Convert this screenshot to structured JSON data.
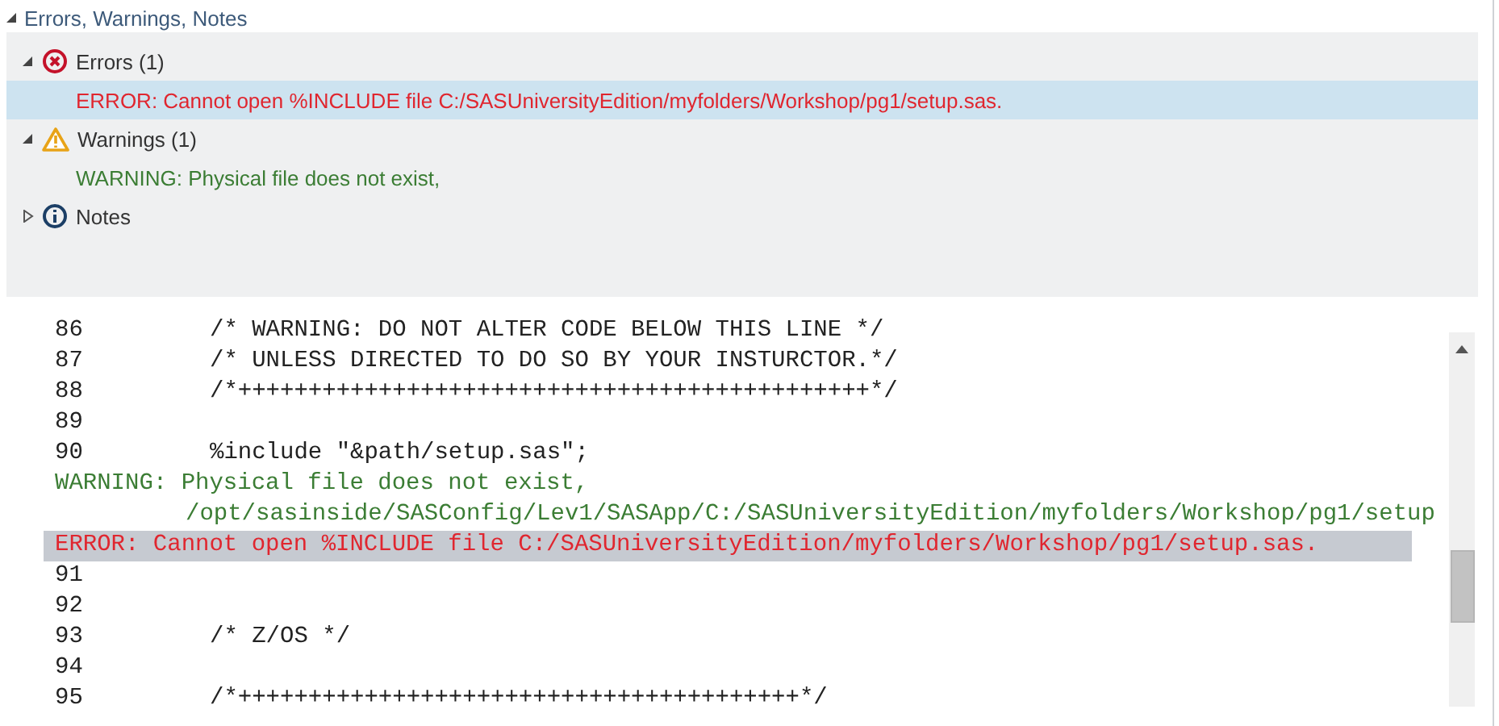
{
  "panel": {
    "title": "Errors, Warnings, Notes",
    "expanded": true,
    "groups": [
      {
        "kind": "error",
        "label": "Errors (1)",
        "expanded": true,
        "messages": [
          {
            "text": "ERROR: Cannot open %INCLUDE file C:/SASUniversityEdition/myfolders/Workshop/pg1/setup.sas.",
            "selected": true
          }
        ]
      },
      {
        "kind": "warning",
        "label": "Warnings (1)",
        "expanded": true,
        "messages": [
          {
            "text": "WARNING: Physical file does not exist,",
            "selected": false
          }
        ]
      },
      {
        "kind": "note",
        "label": "Notes",
        "expanded": false
      }
    ]
  },
  "log": {
    "lines": [
      {
        "kind": "code",
        "number": "86",
        "text": "/* WARNING: DO NOT ALTER CODE BELOW THIS LINE */"
      },
      {
        "kind": "code",
        "number": "87",
        "text": "/* UNLESS DIRECTED TO DO SO BY YOUR INSTURCTOR.*/"
      },
      {
        "kind": "code",
        "number": "88",
        "text": "/*+++++++++++++++++++++++++++++++++++++++++++++*/"
      },
      {
        "kind": "code",
        "number": "89"
      },
      {
        "kind": "code",
        "number": "90",
        "text": "%include \"&path/setup.sas\";"
      },
      {
        "kind": "warning",
        "text": "WARNING: Physical file does not exist,"
      },
      {
        "kind": "warning-continuation",
        "text": "/opt/sasinside/SASConfig/Lev1/SASApp/C:/SASUniversityEdition/myfolders/Workshop/pg1/setup"
      },
      {
        "kind": "error",
        "text": "ERROR: Cannot open %INCLUDE file C:/SASUniversityEdition/myfolders/Workshop/pg1/setup.sas.",
        "selected": true
      },
      {
        "kind": "code",
        "number": "91"
      },
      {
        "kind": "code",
        "number": "92"
      },
      {
        "kind": "code",
        "number": "93",
        "text": "/* Z/OS */"
      },
      {
        "kind": "code",
        "number": "94"
      },
      {
        "kind": "code",
        "number": "95",
        "text": "/*++++++++++++++++++++++++++++++++++++++++*/"
      }
    ]
  }
}
